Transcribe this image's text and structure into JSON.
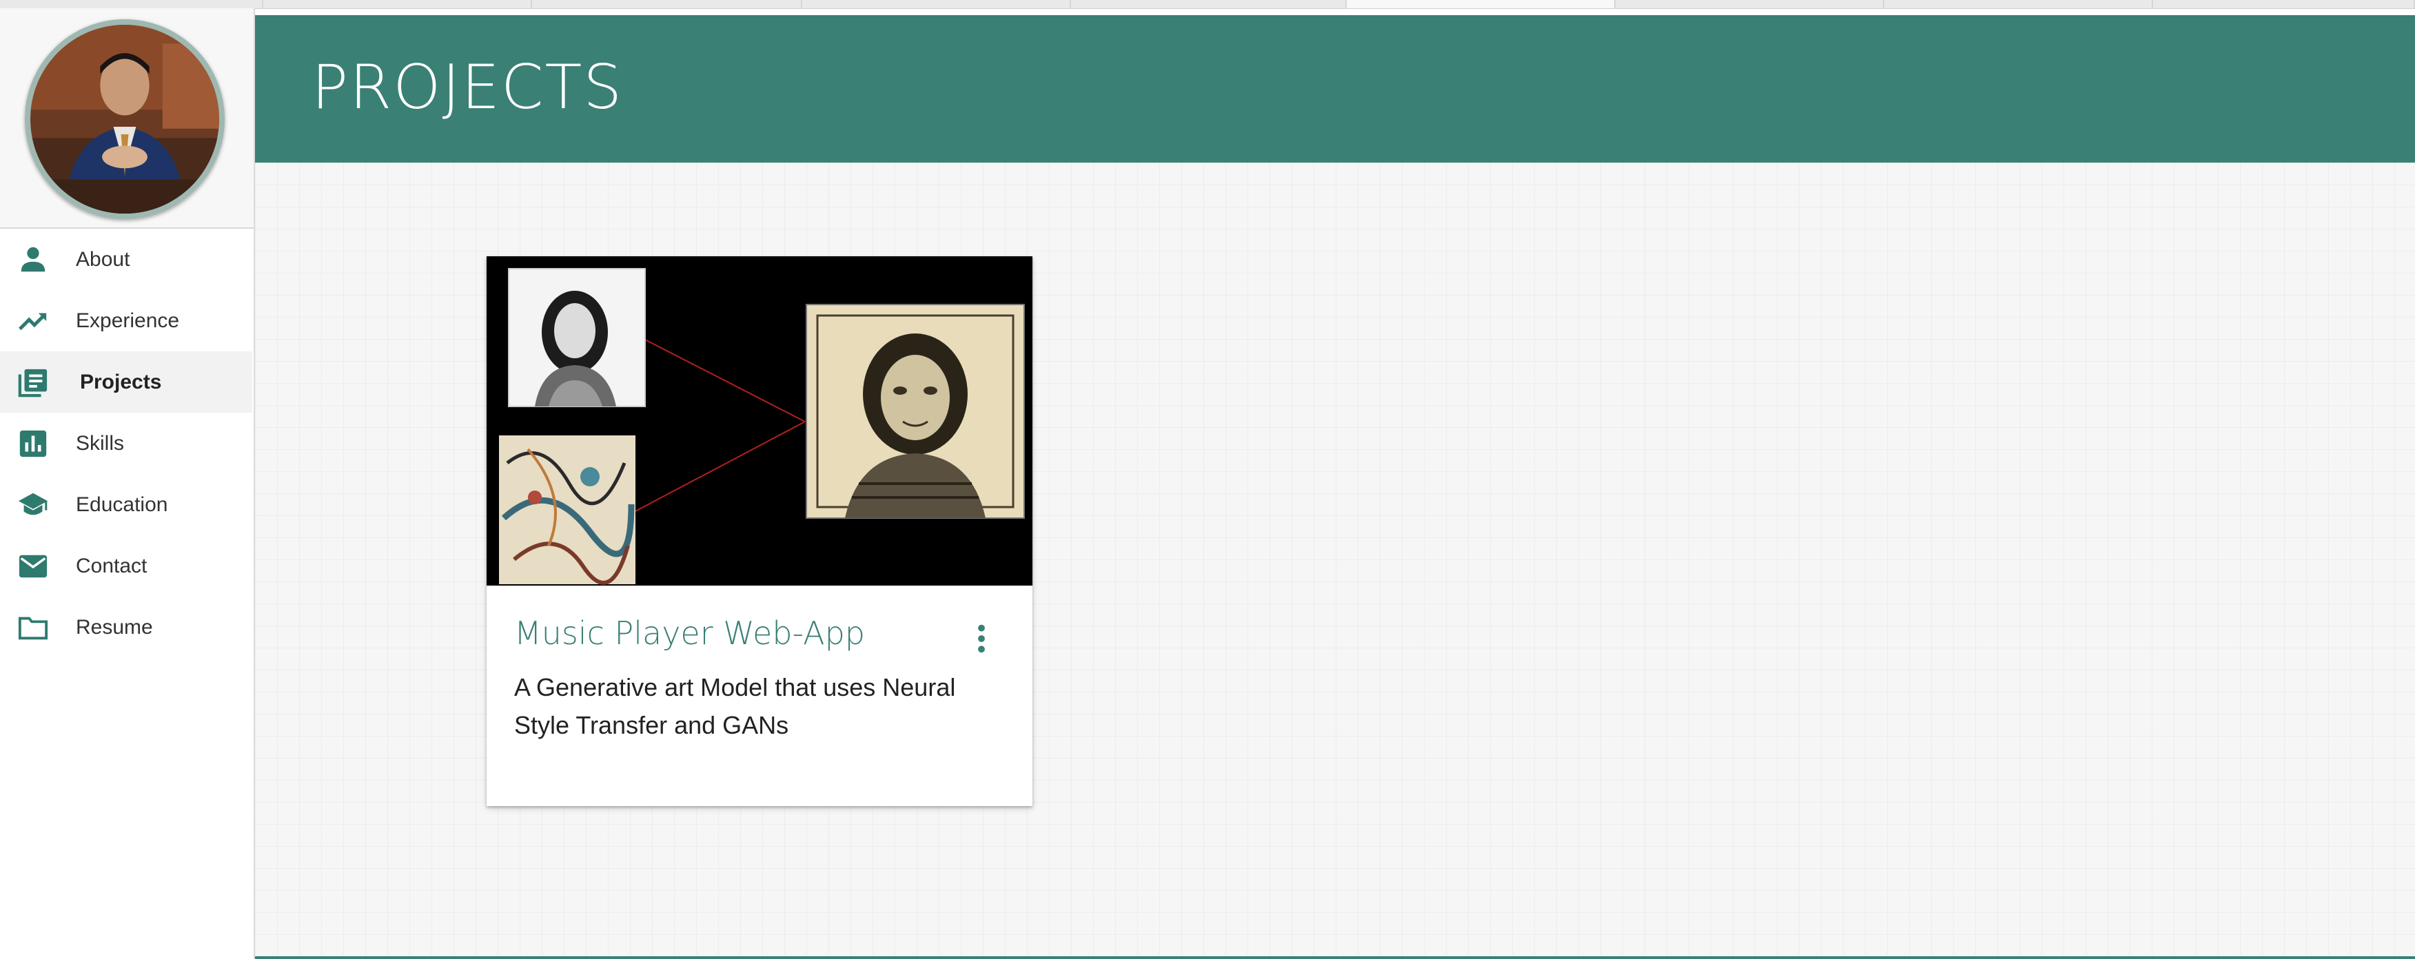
{
  "header": {
    "title": "PROJECTS"
  },
  "sidebar": {
    "items": [
      {
        "label": "About",
        "icon": "person-icon",
        "active": false
      },
      {
        "label": "Experience",
        "icon": "trending-up-icon",
        "active": false
      },
      {
        "label": "Projects",
        "icon": "library-books-icon",
        "active": true
      },
      {
        "label": "Skills",
        "icon": "bar-chart-icon",
        "active": false
      },
      {
        "label": "Education",
        "icon": "graduation-cap-icon",
        "active": false
      },
      {
        "label": "Contact",
        "icon": "mail-icon",
        "active": false
      },
      {
        "label": "Resume",
        "icon": "folder-icon",
        "active": false
      }
    ]
  },
  "card": {
    "title": "Music Player Web-App",
    "description": "A Generative art Model that uses Neural Style Transfer and GANs",
    "menu_icon": "more-vert-icon"
  },
  "colors": {
    "accent": "#3a8075",
    "icon": "#2f7a6e",
    "content_bg": "#f6f6f6"
  }
}
